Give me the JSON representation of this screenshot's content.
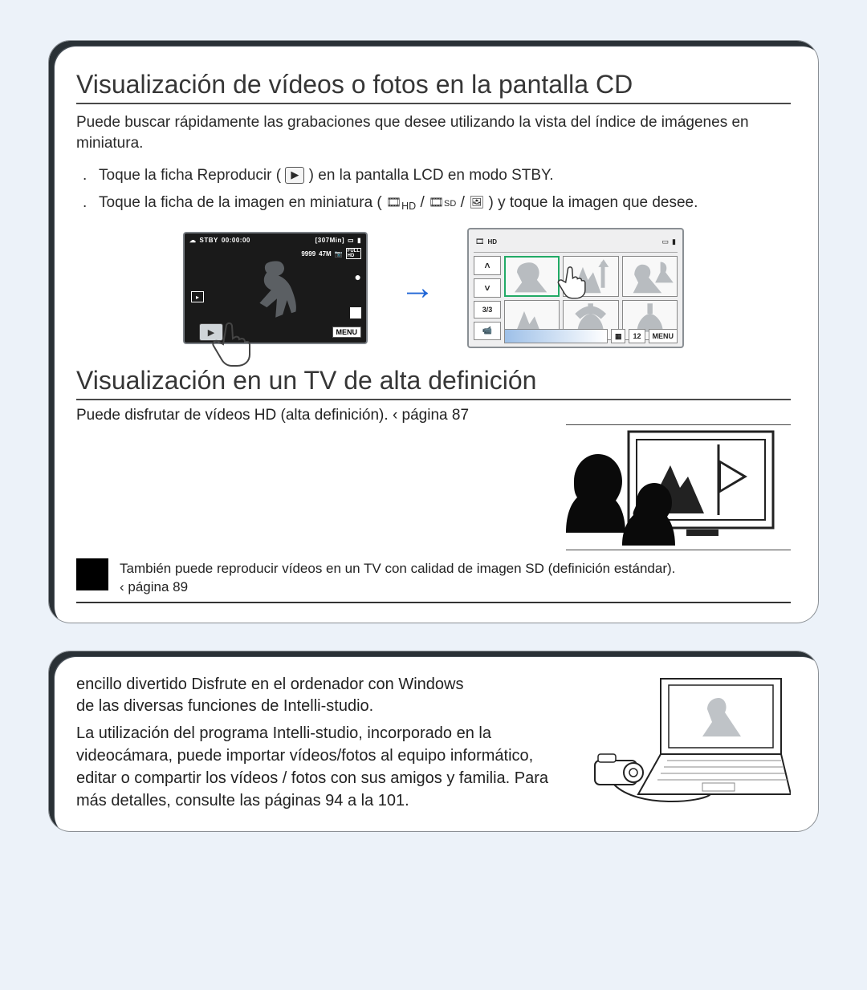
{
  "panel1": {
    "title1": "Visualización de vídeos o fotos en la pantalla CD",
    "intro1": "Puede buscar rápidamente las grabaciones que desee utilizando la vista del índice de imágenes en miniatura.",
    "step1_a": "Toque la ficha Reproducir (",
    "step1_b": ") en la pantalla LCD en modo STBY.",
    "step2_a": "Toque la ficha de la imagen en miniatura (",
    "step2_mid_slash1": " /",
    "step2_mid_sd": "SD",
    "step2_mid_slash2": " /",
    "step2_b": ") y toque la imagen que desee.",
    "lcd": {
      "stby": "STBY",
      "time": "00:00:00",
      "remain": "[307Min]",
      "mem": "9999",
      "shots": "47M",
      "menu": "MENU"
    },
    "thumb": {
      "page": "3/3",
      "menu": "MENU",
      "count": "12",
      "hd_label": "HD"
    },
    "title2": "Visualización en un TV de alta definición",
    "subline_a": "Puede disfrutar de vídeos HD (alta definición).  ",
    "subline_b": "‹ página 87",
    "note_a": "También puede reproducir vídeos en un TV con calidad de imagen SD (definición estándar). ",
    "note_b": "‹ página 89"
  },
  "panel2": {
    "hl_a": "encillo  divertido Disfrute en el ordenador con Windows",
    "hl_b": "de las diversas funciones de Intelli-studio.",
    "desc": "La utilización del programa Intelli-studio, incorporado en la videocámara, puede importar vídeos/fotos al equipo informático, editar o compartir los vídeos / fotos con sus amigos y familia. Para más detalles, consulte las páginas 94 a la 101."
  }
}
